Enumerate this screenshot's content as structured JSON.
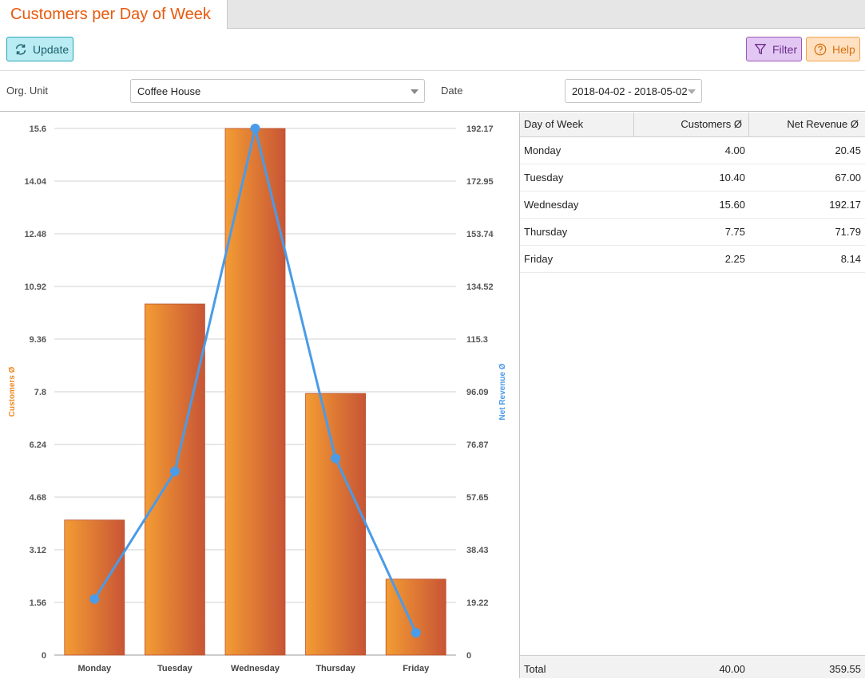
{
  "title": "Customers per Day of Week",
  "toolbar": {
    "update_label": "Update",
    "filter_label": "Filter",
    "help_label": "Help"
  },
  "filters": {
    "org_unit_label": "Org. Unit",
    "org_unit_value": "Coffee House",
    "date_label": "Date",
    "date_value": "2018-04-02 - 2018-05-02"
  },
  "chart_data": {
    "type": "bar",
    "categories": [
      "Monday",
      "Tuesday",
      "Wednesday",
      "Thursday",
      "Friday"
    ],
    "series": [
      {
        "name": "Customers Ø",
        "type": "bar",
        "axis": "left",
        "values": [
          4.0,
          10.4,
          15.6,
          7.75,
          2.25
        ]
      },
      {
        "name": "Net Revenue Ø",
        "type": "line",
        "axis": "right",
        "values": [
          20.45,
          67.0,
          192.17,
          71.79,
          8.14
        ]
      }
    ],
    "ylabel_left": "Customers Ø",
    "ylabel_right": "Net Revenue Ø",
    "ylim_left": [
      0,
      15.6
    ],
    "ylim_right": [
      0,
      192.17
    ],
    "yticks_left": [
      "0",
      "1.56",
      "3.12",
      "4.68",
      "6.24",
      "7.8",
      "9.36",
      "10.92",
      "12.48",
      "14.04",
      "15.6"
    ],
    "yticks_right": [
      "0",
      "19.22",
      "38.43",
      "57.65",
      "76.87",
      "96.09",
      "115.3",
      "134.52",
      "153.74",
      "172.95",
      "192.17"
    ],
    "grid": true,
    "colors": {
      "bar_light": "#f39c34",
      "bar_dark": "#c85535",
      "line": "#4a9be8",
      "left_axis_label": "#f08a24",
      "right_axis_label": "#4a9be8"
    }
  },
  "table": {
    "headers": [
      "Day of Week",
      "Customers Ø",
      "Net Revenue Ø"
    ],
    "rows": [
      [
        "Monday",
        "4.00",
        "20.45"
      ],
      [
        "Tuesday",
        "10.40",
        "67.00"
      ],
      [
        "Wednesday",
        "15.60",
        "192.17"
      ],
      [
        "Thursday",
        "7.75",
        "71.79"
      ],
      [
        "Friday",
        "2.25",
        "8.14"
      ]
    ],
    "footer": [
      "Total",
      "40.00",
      "359.55"
    ]
  }
}
